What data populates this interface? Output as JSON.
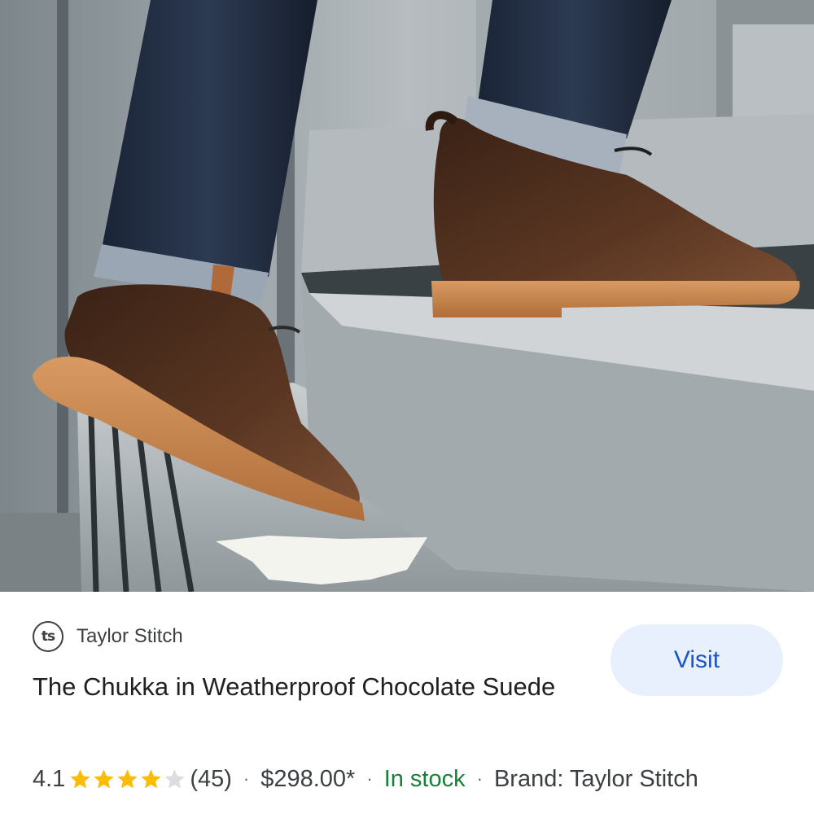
{
  "hero_image": {
    "subject": "product-photo"
  },
  "merchant": {
    "logo_text": "ts",
    "name": "Taylor Stitch"
  },
  "visit_button": {
    "label": "Visit"
  },
  "product": {
    "title": "The Chukka in Weatherproof Chocolate Suede"
  },
  "meta": {
    "rating": "4.1",
    "rating_value": 4.1,
    "stars_max": 5,
    "review_count": "(45)",
    "separator": "·",
    "price": "$298.00*",
    "availability": "In stock",
    "brand": "Brand: Taylor Stitch"
  },
  "colors": {
    "star_filled": "#fbbc04",
    "star_empty": "#dadce0",
    "stock_green": "#188038",
    "visit_bg": "#e8f0fe",
    "visit_text": "#1a57c4"
  }
}
